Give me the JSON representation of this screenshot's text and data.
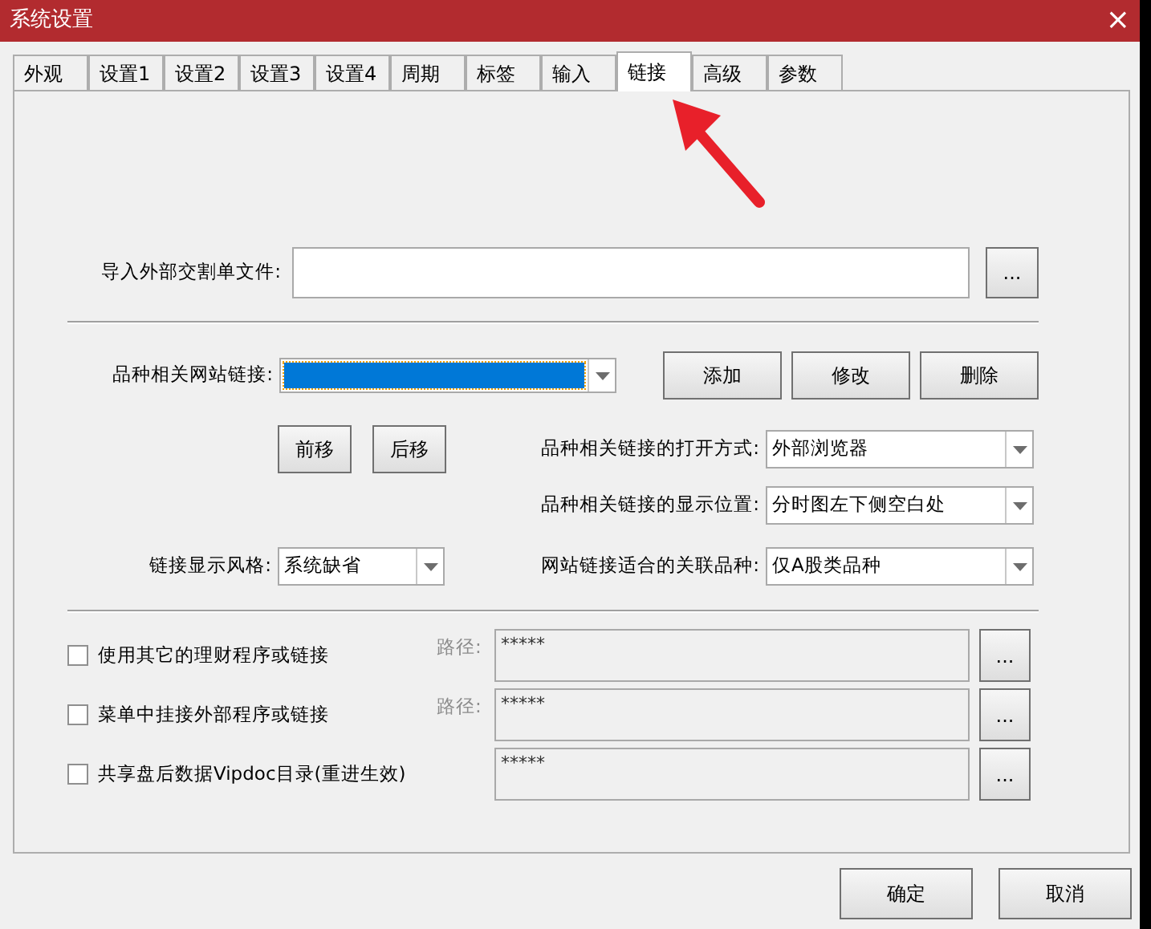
{
  "window": {
    "title": "系统设置",
    "close": "×"
  },
  "tabs": [
    {
      "label": "外观",
      "selected": false
    },
    {
      "label": "设置1",
      "selected": false
    },
    {
      "label": "设置2",
      "selected": false
    },
    {
      "label": "设置3",
      "selected": false
    },
    {
      "label": "设置4",
      "selected": false
    },
    {
      "label": "周期",
      "selected": false
    },
    {
      "label": "标签",
      "selected": false
    },
    {
      "label": "输入",
      "selected": false
    },
    {
      "label": "链接",
      "selected": true
    },
    {
      "label": "高级",
      "selected": false
    },
    {
      "label": "参数",
      "selected": false
    }
  ],
  "import_file": {
    "label": "导入外部交割单文件:",
    "browse": "..."
  },
  "site_link": {
    "label": "品种相关网站链接:",
    "highlighted": true,
    "buttons": [
      "添加",
      "修改",
      "删除"
    ]
  },
  "move_buttons": [
    "前移",
    "后移"
  ],
  "link_style": {
    "label": "链接显示风格:",
    "value": "系统缺省"
  },
  "selects": [
    {
      "label": "品种相关链接的打开方式:",
      "value": "外部浏览器"
    },
    {
      "label": "品种相关链接的显示位置:",
      "value": "分时图左下侧空白处"
    },
    {
      "label": "网站链接适合的关联品种:",
      "value": "仅A股类品种"
    }
  ],
  "options": [
    {
      "label": "使用其它的理财程序或链接",
      "checked": false,
      "path_label": "路径:",
      "value": "*****",
      "browse": "..."
    },
    {
      "label": "菜单中挂接外部程序或链接",
      "checked": false,
      "path_label": "路径:",
      "value": "*****",
      "browse": "..."
    },
    {
      "label": "共享盘后数据Vipdoc目录(重进生效)",
      "checked": false,
      "value": "*****",
      "browse": "..."
    }
  ],
  "dialog_buttons": [
    "确定",
    "取消"
  ]
}
